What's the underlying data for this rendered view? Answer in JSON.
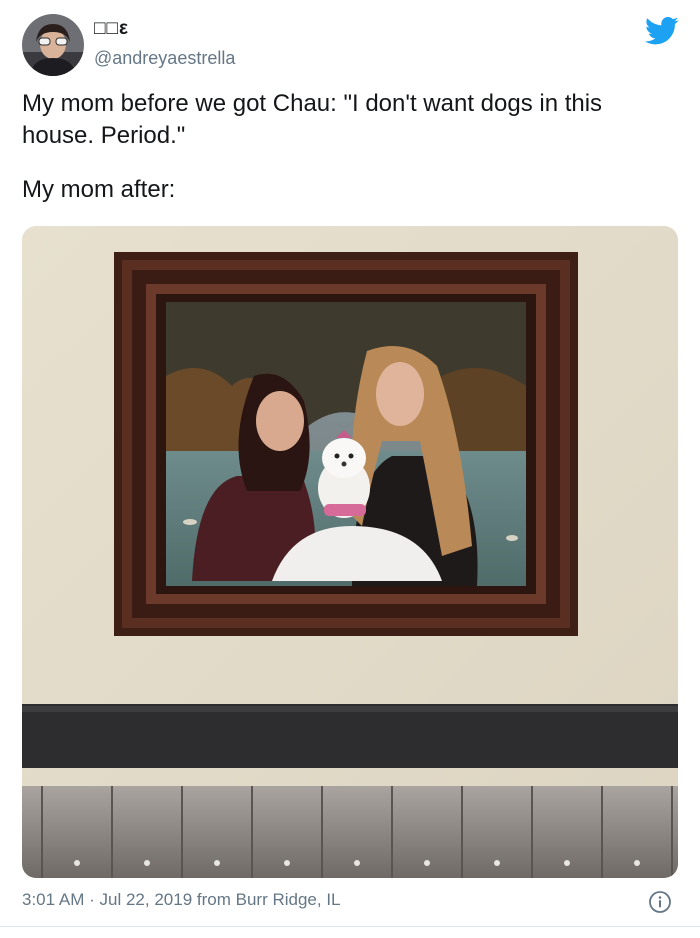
{
  "user": {
    "display_name": "□□ε",
    "handle": "@andreyaestrella"
  },
  "tweet": {
    "line1": "My mom before we got Chau: \"I don't want dogs in this house. Period.\"",
    "line2": "My mom after:"
  },
  "footer": {
    "time": "3:01 AM",
    "separator": "·",
    "date": "Jul 22, 2019",
    "source_prefix": "from",
    "location": "Burr Ridge, IL"
  },
  "icons": {
    "brand": "twitter-bird-icon",
    "info": "info-icon"
  },
  "colors": {
    "brand_blue": "#1da1f2",
    "text_primary": "#14171a",
    "text_secondary": "#657786"
  }
}
